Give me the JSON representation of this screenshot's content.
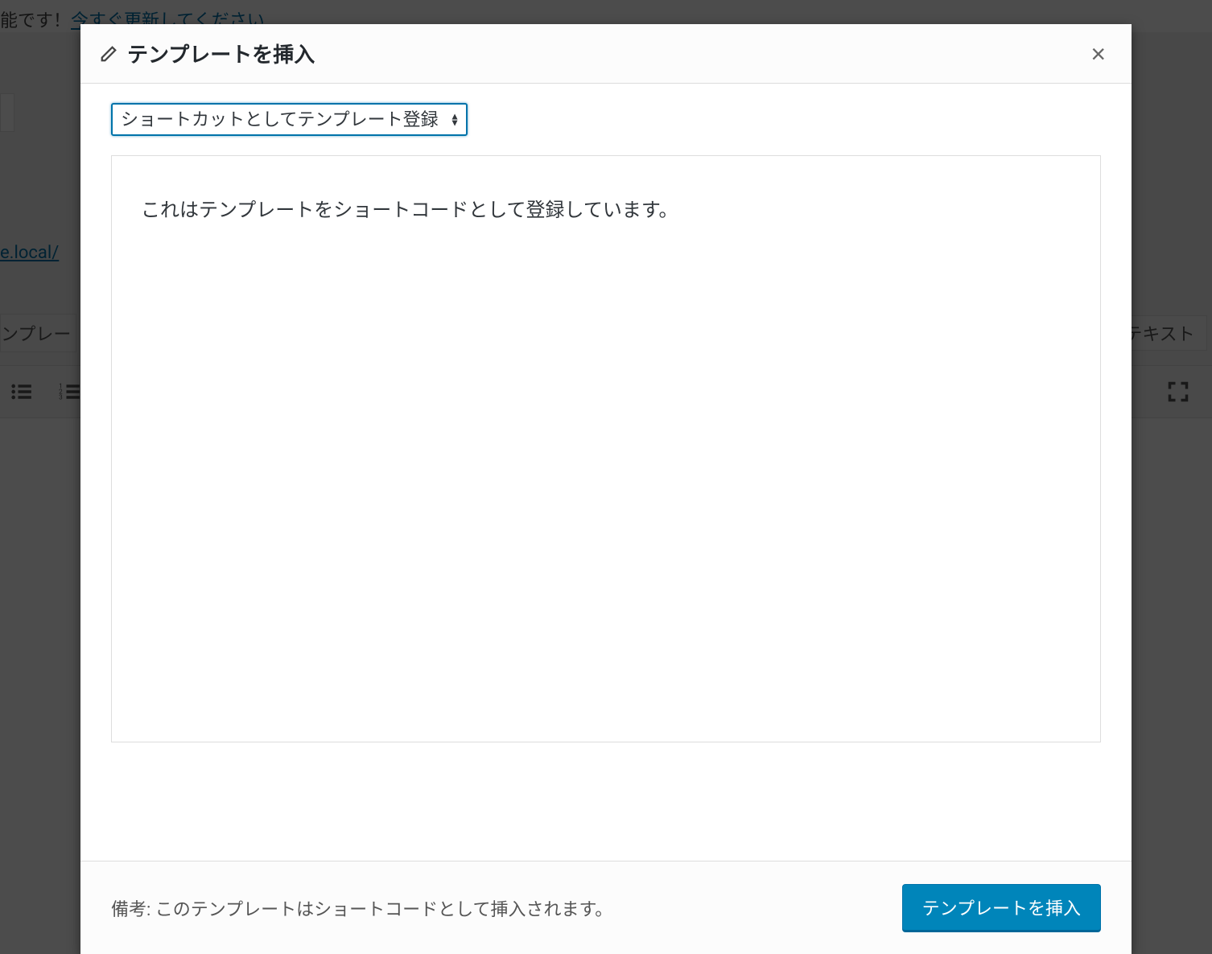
{
  "background": {
    "update_notice_prefix": "能です！",
    "update_link": "今すぐ更新してください",
    "permalink_fragment": "e.local/",
    "tab_left": "ンプレー",
    "tab_right": "テキスト"
  },
  "modal": {
    "title": "テンプレートを挿入",
    "close_symbol": "×",
    "select": {
      "selected": "ショートカットとしてテンプレート登録"
    },
    "preview_text": "これはテンプレートをショートコードとして登録しています。",
    "footer_note": "備考: このテンプレートはショートコードとして挿入されます。",
    "insert_button": "テンプレートを挿入"
  }
}
